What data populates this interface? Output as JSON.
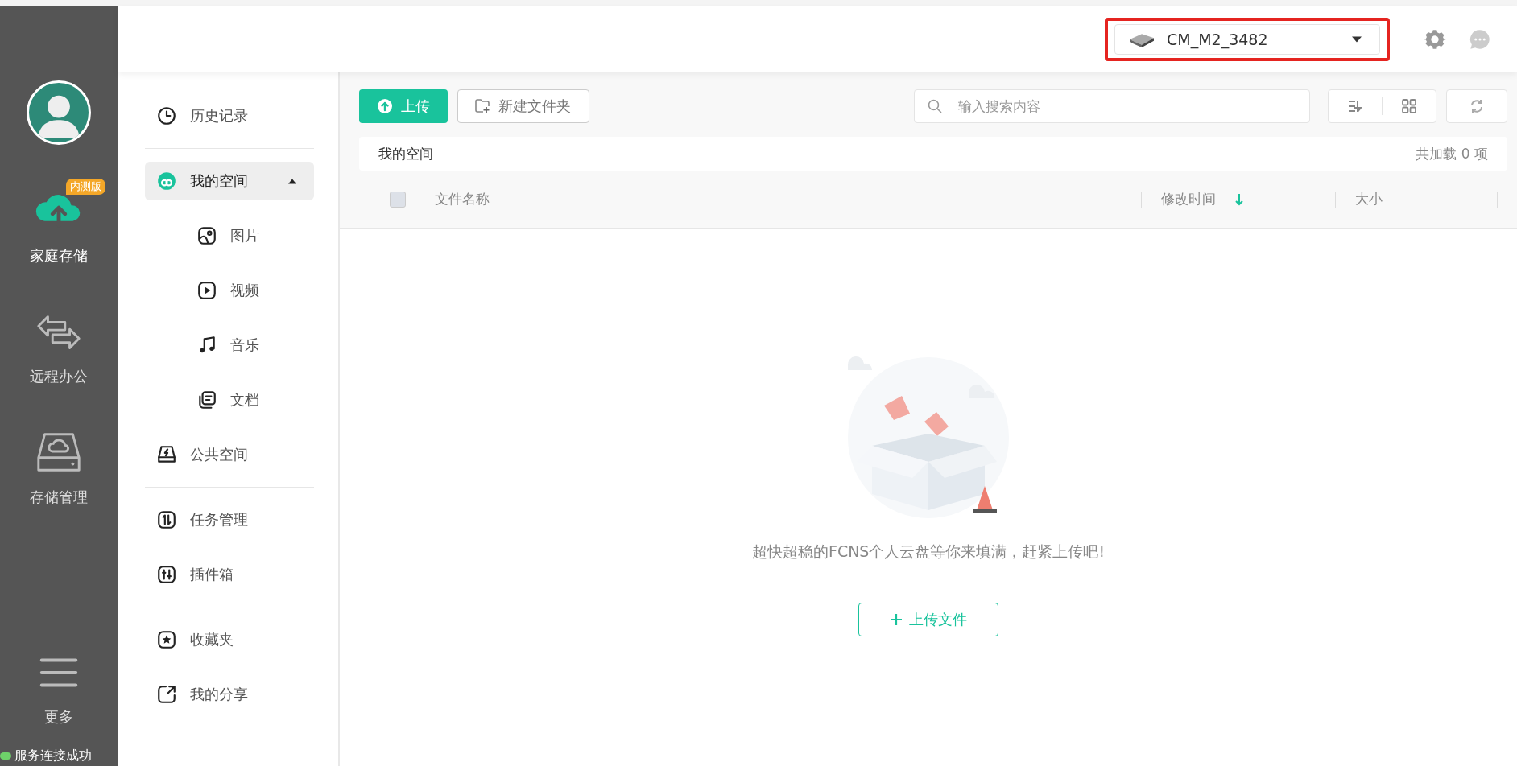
{
  "rail": {
    "items": [
      {
        "label": "家庭存储",
        "selected": true,
        "badge": "内测版"
      },
      {
        "label": "远程办公",
        "selected": false
      },
      {
        "label": "存储管理",
        "selected": false
      },
      {
        "label": "更多",
        "selected": false
      }
    ],
    "status": {
      "text": "服务连接成功",
      "online": true
    }
  },
  "top_bar": {
    "device": {
      "name": "CM_M2_3482",
      "highlighted": true
    }
  },
  "nav": {
    "items": [
      {
        "kind": "item",
        "label": "历史记录",
        "selected": false
      },
      {
        "kind": "divider"
      },
      {
        "kind": "item",
        "label": "我的空间",
        "selected": true,
        "expanded": true,
        "children": [
          {
            "label": "图片",
            "selected": false
          },
          {
            "label": "视频",
            "selected": false
          },
          {
            "label": "音乐",
            "selected": false
          },
          {
            "label": "文档",
            "selected": false
          }
        ]
      },
      {
        "kind": "item",
        "label": "公共空间",
        "selected": false
      },
      {
        "kind": "divider"
      },
      {
        "kind": "item",
        "label": "任务管理",
        "selected": false
      },
      {
        "kind": "item",
        "label": "插件箱",
        "selected": false
      },
      {
        "kind": "divider"
      },
      {
        "kind": "item",
        "label": "收藏夹",
        "selected": false
      },
      {
        "kind": "item",
        "label": "我的分享",
        "selected": false
      }
    ]
  },
  "toolbar": {
    "upload": "上传",
    "new_folder": "新建文件夹",
    "search": {
      "placeholder": "输入搜索内容"
    }
  },
  "breadcrumb": {
    "path": "我的空间",
    "count": "共加载 0 项"
  },
  "table": {
    "select_all": {
      "checked": false
    },
    "columns": [
      {
        "label": "文件名称",
        "sorted": false
      },
      {
        "label": "修改时间",
        "sorted": true
      },
      {
        "label": "大小",
        "sorted": false
      }
    ]
  },
  "empty_state": {
    "message": "超快超稳的FCNS个人云盘等你来填满，赶紧上传吧!",
    "button": "上传文件"
  }
}
